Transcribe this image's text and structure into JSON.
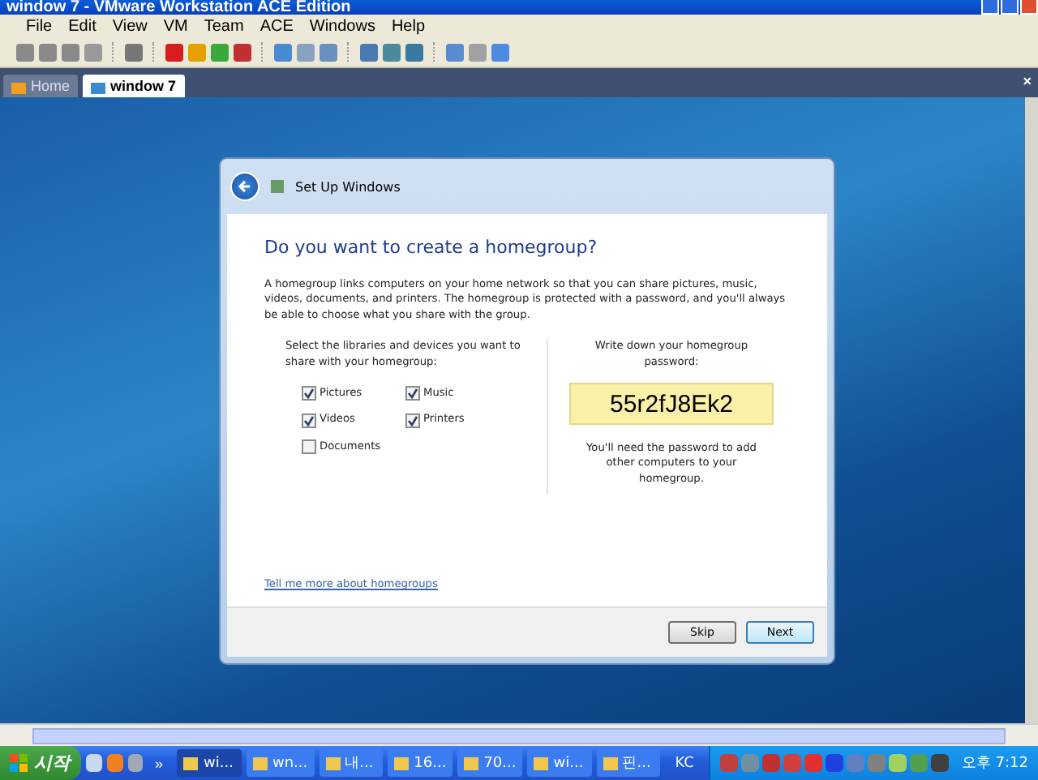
{
  "window": {
    "title": "window 7 - VMware Workstation ACE Edition"
  },
  "menu": [
    "File",
    "Edit",
    "View",
    "VM",
    "Team",
    "ACE",
    "Windows",
    "Help"
  ],
  "tabs": [
    {
      "label": "Home",
      "selected": false
    },
    {
      "label": "window 7",
      "selected": true
    }
  ],
  "tab_close": "×",
  "dialog": {
    "title": "Set Up Windows",
    "heading": "Do you want to create a homegroup?",
    "intro": "A homegroup links computers on your home network so that you can share pictures, music, videos, documents, and printers. The homegroup is protected with a password, and you'll always be able to choose what you share with the group.",
    "select_label": "Select the libraries and devices you want to share with your homegroup:",
    "libraries": [
      {
        "label": "Pictures",
        "checked": true
      },
      {
        "label": "Music",
        "checked": true
      },
      {
        "label": "Videos",
        "checked": true
      },
      {
        "label": "Printers",
        "checked": true
      },
      {
        "label": "Documents",
        "checked": false
      }
    ],
    "password_label": "Write down your homegroup password:",
    "password": "55r2fJ8Ek2",
    "password_note": "You'll need the password to add other computers to your homegroup.",
    "link": "Tell me more about homegroups",
    "buttons": [
      {
        "label": "Skip",
        "default": false
      },
      {
        "label": "Next",
        "default": true
      }
    ]
  },
  "taskbar": {
    "start": "시작",
    "more": "»",
    "items": [
      {
        "label": "wi...",
        "selected": true
      },
      {
        "label": "wn...",
        "selected": false
      },
      {
        "label": "내...",
        "selected": false
      },
      {
        "label": "16...",
        "selected": false
      },
      {
        "label": "70...",
        "selected": false
      },
      {
        "label": "wi...",
        "selected": false
      },
      {
        "label": "핀...",
        "selected": false
      }
    ],
    "language": "KC",
    "clock": "오후 7:12"
  }
}
